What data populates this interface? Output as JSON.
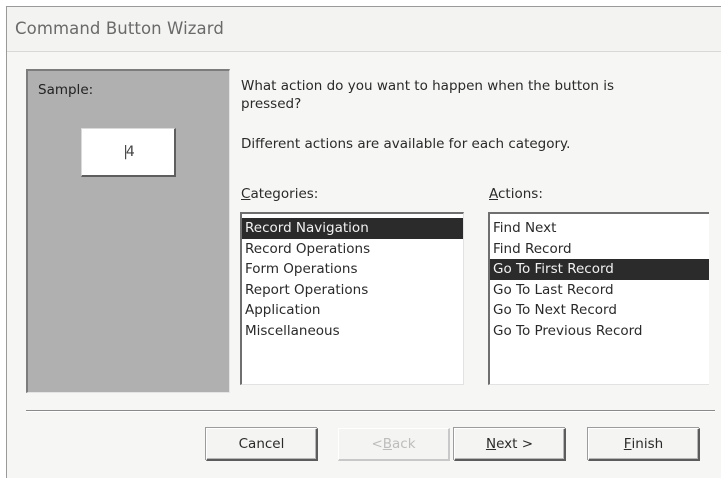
{
  "window": {
    "title": "Command Button Wizard"
  },
  "sample": {
    "label": "Sample:",
    "button_glyph": "|4"
  },
  "prompt": {
    "question": "What action do you want to happen when the button is pressed?",
    "subtext": "Different actions are available for each category."
  },
  "categories": {
    "label_first": "C",
    "label_rest": "ategories:",
    "items": [
      {
        "label": "Record Navigation",
        "selected": true
      },
      {
        "label": "Record Operations",
        "selected": false
      },
      {
        "label": "Form Operations",
        "selected": false
      },
      {
        "label": "Report Operations",
        "selected": false
      },
      {
        "label": "Application",
        "selected": false
      },
      {
        "label": "Miscellaneous",
        "selected": false
      }
    ]
  },
  "actions": {
    "label_first": "A",
    "label_rest": "ctions:",
    "items": [
      {
        "label": "Find Next",
        "selected": false
      },
      {
        "label": "Find Record",
        "selected": false
      },
      {
        "label": "Go To First Record",
        "selected": true
      },
      {
        "label": "Go To Last Record",
        "selected": false
      },
      {
        "label": "Go To Next Record",
        "selected": false
      },
      {
        "label": "Go To Previous Record",
        "selected": false
      }
    ]
  },
  "buttons": {
    "cancel": {
      "label": "Cancel"
    },
    "back": {
      "prefix": "< ",
      "mnemonic": "B",
      "rest": "ack",
      "disabled": true
    },
    "next": {
      "mnemonic": "N",
      "rest": "ext >"
    },
    "finish": {
      "mnemonic": "F",
      "rest": "inish"
    }
  }
}
